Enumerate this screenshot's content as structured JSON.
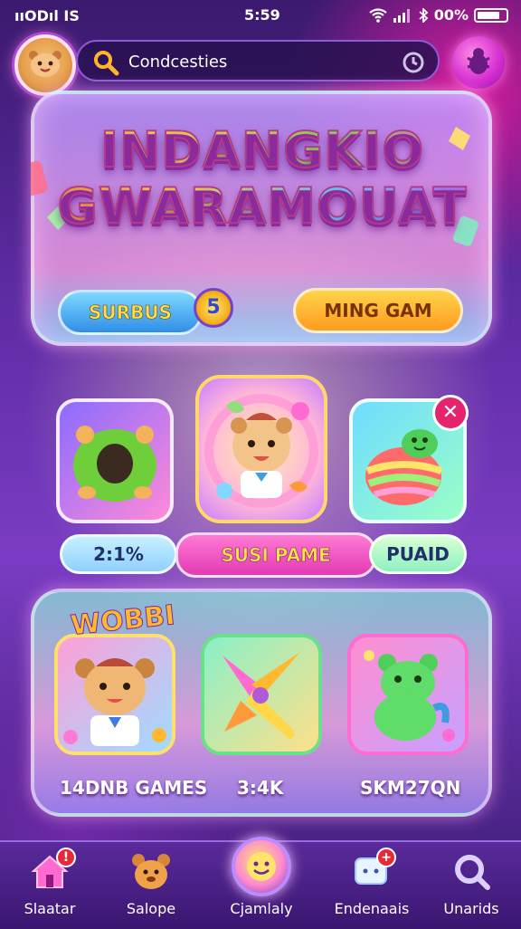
{
  "status_bar": {
    "left": "ııODıl IS",
    "time": "5:59",
    "battery": "00%"
  },
  "search": {
    "text": "Condcesties"
  },
  "title": {
    "line1": "INDANGKIO",
    "line2": "GWARAMOUAT"
  },
  "buttons": {
    "left": "SURBUS",
    "coin": "5",
    "right": "MING GAM"
  },
  "stats": {
    "left": "2:1%",
    "mid": "SUSI PAME",
    "right": "PUAID"
  },
  "sticker": "WOBBI",
  "captions": {
    "left": "14DNB GAMES",
    "mid": "3:4K",
    "right": "SKM27QN"
  },
  "nav": [
    {
      "label": "Slaatar",
      "icon": "home-icon"
    },
    {
      "label": "Salope",
      "icon": "bear-icon"
    },
    {
      "label": "Cjamlaly",
      "icon": "smiley-icon"
    },
    {
      "label": "Endenaais",
      "icon": "chat-icon"
    },
    {
      "label": "Unarids",
      "icon": "magnifier-icon"
    }
  ],
  "colors": {
    "accent_pink": "#ff6bd0",
    "accent_gold": "#ffd84a",
    "nav_bg": "#3a1670"
  }
}
